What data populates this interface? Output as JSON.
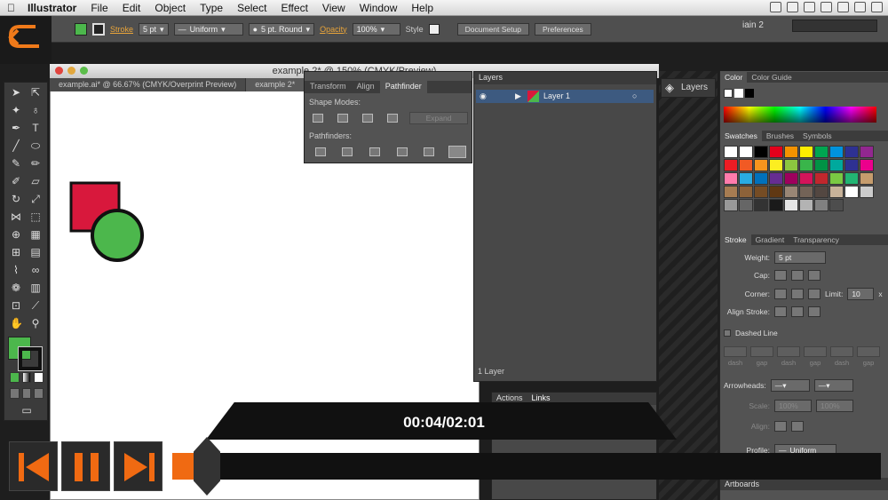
{
  "menubar": {
    "app": "Illustrator",
    "items": [
      "File",
      "Edit",
      "Object",
      "Type",
      "Select",
      "Effect",
      "View",
      "Window",
      "Help"
    ],
    "user": "iain 2"
  },
  "control": {
    "stroke_label": "Stroke",
    "stroke_weight": "5 pt",
    "profile": "Uniform",
    "brush": "5 pt. Round",
    "opacity_label": "Opacity",
    "opacity_value": "100%",
    "style_label": "Style",
    "doc_setup": "Document Setup",
    "preferences": "Preferences",
    "fill_color": "#4cb74c",
    "stroke_color": "#111111"
  },
  "document": {
    "title": "example 2* @ 150% (CMYK/Preview)",
    "tabs": [
      "example.ai* @ 66.67% (CMYK/Overprint Preview)",
      "example 2*"
    ]
  },
  "artwork": {
    "square_color": "#d8183c",
    "circle_color": "#4cb74c",
    "outline": "#111111"
  },
  "pathfinder": {
    "tabs": [
      "Transform",
      "Align",
      "Pathfinder"
    ],
    "shape_modes_label": "Shape Modes:",
    "expand_label": "Expand",
    "pathfinders_label": "Pathfinders:"
  },
  "layers": {
    "title": "Layers",
    "layer_name": "Layer 1",
    "count": "1 Layer",
    "dock_label": "Layers"
  },
  "actions": {
    "tabs": [
      "Actions",
      "Links"
    ]
  },
  "color_panel": {
    "tabs": [
      "Color",
      "Color Guide"
    ]
  },
  "swatches": {
    "tabs": [
      "Swatches",
      "Brushes",
      "Symbols"
    ],
    "colors": [
      "#ffffff",
      "#ffffff",
      "#000000",
      "#e3001b",
      "#f39200",
      "#ffed00",
      "#00a651",
      "#0093dd",
      "#2e3192",
      "#92278f",
      "#ed1c24",
      "#f15a24",
      "#f7941d",
      "#fcee21",
      "#8cc63f",
      "#39b54a",
      "#009245",
      "#00a99d",
      "#2e3192",
      "#ec008c",
      "#ff7bac",
      "#29abe2",
      "#0071bc",
      "#662d91",
      "#9e005d",
      "#d4145a",
      "#c1272d",
      "#7ac943",
      "#22b573",
      "#c69c6d",
      "#a67c52",
      "#8c6239",
      "#754c24",
      "#603813",
      "#998675",
      "#736357",
      "#534741",
      "#c7b299",
      "#ffffff",
      "#cccccc",
      "#999999",
      "#666666",
      "#333333",
      "#1a1a1a",
      "#e6e6e6",
      "#b3b3b3",
      "#808080",
      "#4d4d4d"
    ]
  },
  "stroke_panel": {
    "tabs": [
      "Stroke",
      "Gradient",
      "Transparency"
    ],
    "weight_label": "Weight:",
    "weight_value": "5 pt",
    "cap_label": "Cap:",
    "corner_label": "Corner:",
    "limit_label": "Limit:",
    "limit_value": "10",
    "limit_unit": "x",
    "align_label": "Align Stroke:",
    "dashed_label": "Dashed Line",
    "dash_labels": [
      "dash",
      "gap",
      "dash",
      "gap",
      "dash",
      "gap"
    ],
    "arrowheads_label": "Arrowheads:",
    "scale_label": "Scale:",
    "scale_1": "100%",
    "scale_2": "100%",
    "align2_label": "Align:",
    "profile_label": "Profile:",
    "profile_value": "Uniform"
  },
  "artboards": {
    "label": "Artboards"
  },
  "video": {
    "timecode": "00:04/02:01",
    "progress": 0.033
  }
}
